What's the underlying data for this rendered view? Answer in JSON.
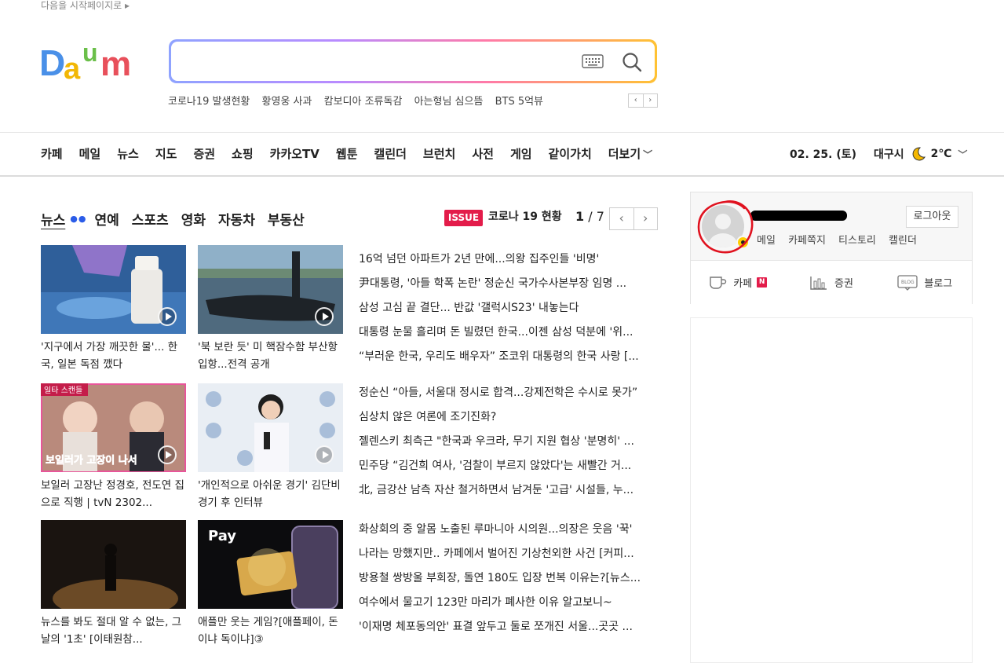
{
  "header": {
    "start_page_link": "다음을 시작페이지로 ▸",
    "logo_text": "Daum"
  },
  "search": {
    "placeholder": "",
    "value": ""
  },
  "trends": [
    "코로나19 발생현황",
    "황영웅 사과",
    "캄보디아 조류독감",
    "아는형님 심으뜸",
    "BTS 5억뷰"
  ],
  "trend_pager": {
    "prev": "‹",
    "next": "›"
  },
  "gnb": [
    "카페",
    "메일",
    "뉴스",
    "지도",
    "증권",
    "쇼핑",
    "카카오TV",
    "웹툰",
    "캘린더",
    "브런치",
    "사전",
    "게임",
    "같이가치",
    "더보기"
  ],
  "weather": {
    "date": "02. 25. (토)",
    "city": "대구시",
    "temp": "2℃"
  },
  "news_tabs": [
    "뉴스",
    "연예",
    "스포츠",
    "영화",
    "자동차",
    "부동산"
  ],
  "issue": {
    "badge": "ISSUE",
    "title": "코로나 19 현황",
    "current": "1",
    "total": "/ 7"
  },
  "cards": [
    {
      "caption": "'지구에서 가장 깨끗한 물'... 한국, 일본 독점 깼다",
      "video": true,
      "thumb_color": "#3d6fa8"
    },
    {
      "caption": "'북 보란 듯' 미 핵잠수함 부산항 입항...전격 공개",
      "video": true,
      "thumb_color": "#7d9bb5"
    },
    {
      "caption": "보일러 고장난 정경호, 전도연 집으로 직행 | tvN 2302...",
      "video": true,
      "thumb_color": "#c98a8a",
      "overlay_tag": "일타 스캔들",
      "overlay_text": "보일러가 고장이 나서"
    },
    {
      "caption": "'개인적으로 아쉬운 경기' 김단비 경기 후 인터뷰",
      "video": true,
      "thumb_color": "#d9e4ef"
    },
    {
      "caption": "뉴스를 봐도 절대 알 수 없는, 그 날의 '1초' [이태원참...",
      "video": false,
      "thumb_color": "#2a2118"
    },
    {
      "caption": "애플만 웃는 게임?[애플페이, 돈이냐 독이냐]③",
      "video": false,
      "thumb_color": "#111111",
      "overlay_text": "Pay"
    }
  ],
  "headlines": [
    [
      "16억 넘던 아파트가 2년 만에...의왕 집주인들 '비명'",
      "尹대통령, '아들 학폭 논란' 정순신 국가수사본부장 임명 ...",
      "삼성 고심 끝 결단... 반값 '갤럭시S23' 내놓는다",
      "대통령 눈물 흘리며 돈 빌렸던 한국...이젠 삼성 덕분에 '위...",
      "“부러운 한국, 우리도 배우자” 조코위 대통령의 한국 사랑 [..."
    ],
    [
      "정순신 “아들, 서울대 정시로 합격...강제전학은 수시로 못가”",
      "심상치 않은 여론에 조기진화?",
      "젤렌스키 최측근 \"한국과 우크라, 무기 지원 협상 '분명히' ...",
      "민주당 “김건희 여사, '검찰이 부르지 않았다'는 새빨간 거...",
      "北, 금강산 남측 자산 철거하면서 남겨둔 '고급' 시설들, 누..."
    ],
    [
      "화상회의 중 알몸 노출된 루마니아 시의원...의장은 웃음 '꾹'",
      "나라는 망했지만.. 카페에서 벌어진 기상천외한 사건 [커피...",
      "방용철 쌍방울 부회장, 돌연 180도 입장 번복 이유는?[뉴스...",
      "여수에서 물고기 123만 마리가 폐사한 이유 알고보니~",
      "'이재명 체포동의안' 표결 앞두고 둘로 쪼개진 서울...곳곳 ..."
    ]
  ],
  "profile": {
    "logout": "로그아웃",
    "links": [
      "메일",
      "카페쪽지",
      "티스토리",
      "캘린더"
    ]
  },
  "services": [
    {
      "label": "카페",
      "badge": "N"
    },
    {
      "label": "증권"
    },
    {
      "label": "블로그"
    }
  ],
  "colors": {
    "accent": "#2b5ce8",
    "issue_red": "#e31c4a",
    "annotation": "#e0121f"
  }
}
